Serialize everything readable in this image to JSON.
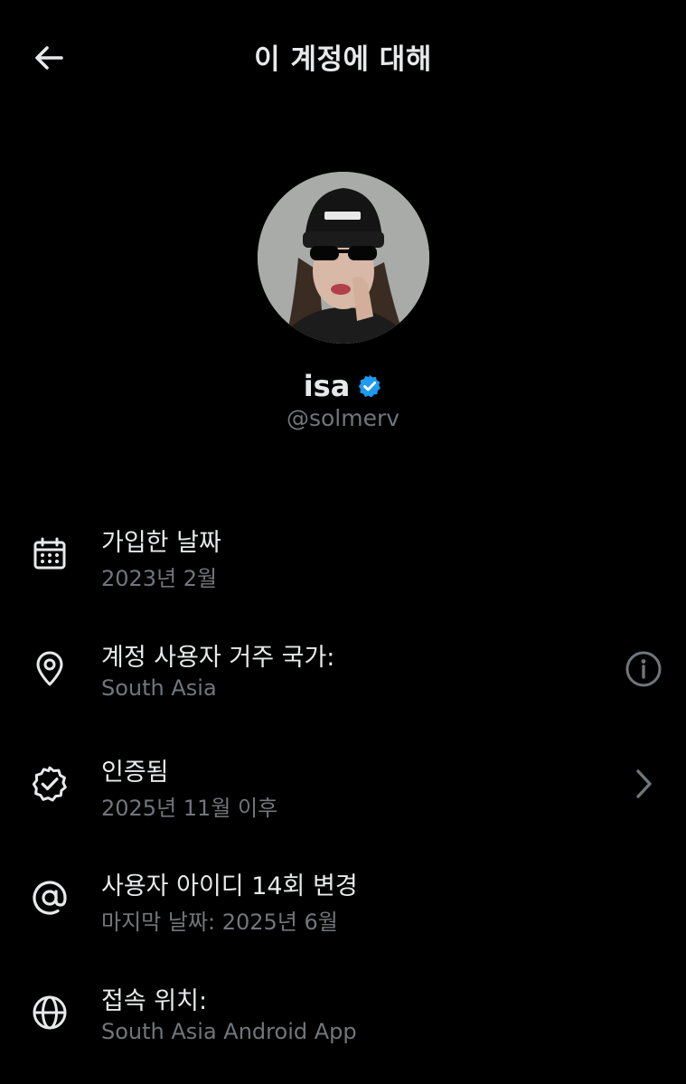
{
  "header": {
    "title": "이 계정에 대해",
    "back_icon": "arrow-left-icon"
  },
  "profile": {
    "display_name": "isa",
    "handle": "@solmerv",
    "verified_icon": "verified-badge-icon",
    "verified_color": "#1d9bf0"
  },
  "rows": [
    {
      "icon": "calendar-icon",
      "title": "가입한 날짜",
      "subtitle": "2023년 2월"
    },
    {
      "icon": "location-pin-icon",
      "title": "계정 사용자 거주 국가:",
      "subtitle": "South Asia",
      "right_icon": "info-icon"
    },
    {
      "icon": "verified-outline-icon",
      "title": "인증됨",
      "subtitle": "2025년 11월 이후",
      "right_icon": "chevron-right-icon"
    },
    {
      "icon": "at-sign-icon",
      "title": "사용자 아이디 14회 변경",
      "subtitle": "마지막 날짜: 2025년 6월"
    },
    {
      "icon": "globe-icon",
      "title": "접속 위치:",
      "subtitle": "South Asia Android App"
    }
  ],
  "colors": {
    "background": "#000000",
    "primary_text": "#e7e9ea",
    "secondary_text": "#71767b"
  }
}
